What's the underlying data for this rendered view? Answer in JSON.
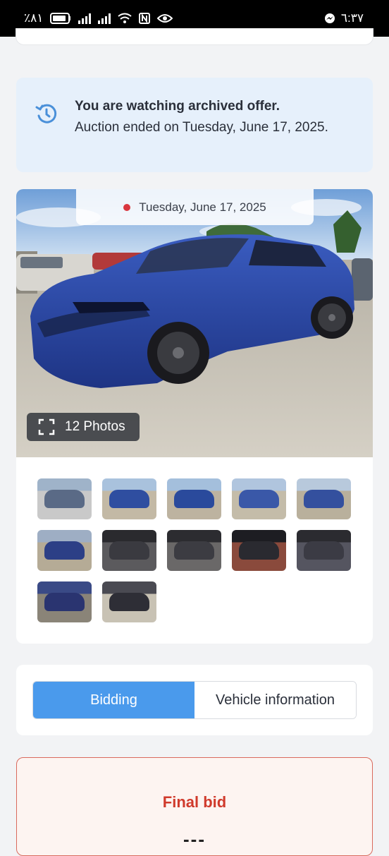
{
  "status_bar": {
    "battery": "٪٨١",
    "time": "٦:٣٧"
  },
  "archive_notice": {
    "title": "You are watching archived offer.",
    "message": "Auction ended on Tuesday, June 17, 2025."
  },
  "gallery": {
    "date": "Tuesday, June 17, 2025",
    "photos_label": "12 Photos",
    "thumbnails": [
      {
        "name": "thumb-1",
        "colors": [
          "#9fb3c9",
          "#c9c9c9",
          "#5a6a86"
        ]
      },
      {
        "name": "thumb-2",
        "colors": [
          "#a9c2dd",
          "#c3b9a5",
          "#2f4ea0"
        ]
      },
      {
        "name": "thumb-3",
        "colors": [
          "#a4bfdc",
          "#bdb3a0",
          "#2a4a9c"
        ]
      },
      {
        "name": "thumb-4",
        "colors": [
          "#b0c5de",
          "#c4bca9",
          "#3a58a8"
        ]
      },
      {
        "name": "thumb-5",
        "colors": [
          "#b8c9dc",
          "#b9b09c",
          "#34509e"
        ]
      },
      {
        "name": "thumb-6",
        "colors": [
          "#9eaec4",
          "#b5ab96",
          "#2c3f86"
        ]
      },
      {
        "name": "thumb-7",
        "colors": [
          "#2a2a2e",
          "#5b5a5d",
          "#3a3a40"
        ]
      },
      {
        "name": "thumb-8",
        "colors": [
          "#2c2c30",
          "#6a6868",
          "#3c3c42"
        ]
      },
      {
        "name": "thumb-9",
        "colors": [
          "#1d1d22",
          "#8a4a3c",
          "#2a2a30"
        ]
      },
      {
        "name": "thumb-10",
        "colors": [
          "#2b2b30",
          "#555560",
          "#3b3b44"
        ]
      },
      {
        "name": "thumb-11",
        "colors": [
          "#3a4a86",
          "#8a8478",
          "#2a3470"
        ]
      },
      {
        "name": "thumb-12",
        "colors": [
          "#4a4a52",
          "#c8c2b4",
          "#2e2e36"
        ]
      }
    ]
  },
  "tabs": [
    {
      "label": "Bidding",
      "active": true
    },
    {
      "label": "Vehicle information",
      "active": false
    }
  ],
  "final_bid": {
    "title": "Final bid",
    "value": "---"
  }
}
